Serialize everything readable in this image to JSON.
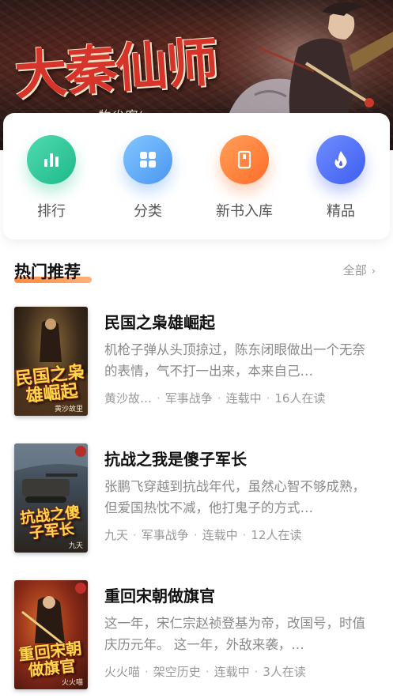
{
  "banner": {
    "title": "大秦仙师",
    "subtitle": "牧尘客/"
  },
  "quick_nav": [
    {
      "label": "排行",
      "icon": "ranking-icon",
      "color": "#2cc596"
    },
    {
      "label": "分类",
      "icon": "category-icon",
      "color": "#5aa7f5"
    },
    {
      "label": "新书入库",
      "icon": "new-book-icon",
      "color": "#ff7a32"
    },
    {
      "label": "精品",
      "icon": "flame-icon",
      "color": "#4b69f2"
    }
  ],
  "section": {
    "title": "热门推荐",
    "more_label": "全部",
    "accent": "#ff8a3d"
  },
  "books": [
    {
      "title": "民国之枭雄崛起",
      "description": "机枪子弹从头顶掠过，陈东闭眼做出一个无奈的表情，气不打一出来，本来自己…",
      "author": "黄沙故…",
      "category": "军事战争",
      "status": "连载中",
      "readers": "16人在读",
      "cover_text": "民国之枭雄崛起",
      "cover_author": "黄沙故里"
    },
    {
      "title": "抗战之我是傻子军长",
      "description": "张鹏飞穿越到抗战年代，虽然心智不够成熟，但爱国热忱不减，他打鬼子的方式…",
      "author": "九天",
      "category": "军事战争",
      "status": "连载中",
      "readers": "12人在读",
      "cover_text": "抗战之傻子军长",
      "cover_author": "九天"
    },
    {
      "title": "重回宋朝做旗官",
      "description": "这一年，宋仁宗赵祯登基为帝，改国号，时值庆历元年。 这一年，外敌来袭，…",
      "author": "火火喵",
      "category": "架空历史",
      "status": "连载中",
      "readers": "3人在读",
      "cover_text": "重回宋朝做旗官",
      "cover_author": "火火喵"
    }
  ]
}
